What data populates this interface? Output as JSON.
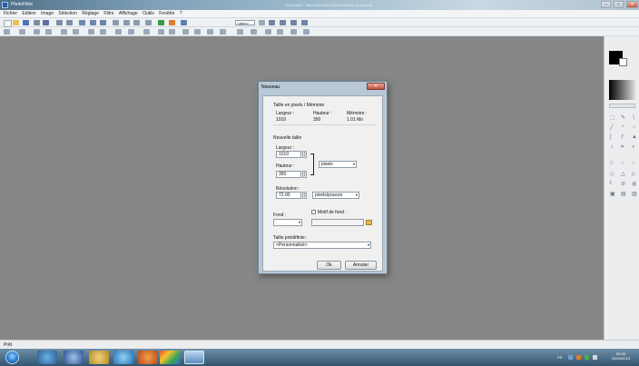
{
  "window": {
    "app_title": "PhotoFiltre",
    "doc_title": "Document - Microsoft Word (Désactivation du produit)",
    "controls": {
      "minimize": "–",
      "maximize": "□",
      "close": "✕"
    }
  },
  "menu": [
    "Fichier",
    "Edition",
    "Image",
    "Sélection",
    "Réglage",
    "Filtre",
    "Affichage",
    "Outils",
    "Fenêtre",
    "?"
  ],
  "toolbar": {
    "zoom_value": "<Auto>"
  },
  "dialog": {
    "title": "Nouveau",
    "close": "✕",
    "section_memory": "Taille en pixels / Mémoire",
    "memory_headers": [
      "Largeur :",
      "Hauteur :",
      "Mémoire :"
    ],
    "memory_values": [
      "1010",
      "350",
      "1.01 Mo"
    ],
    "section_new": "Nouvelle taille",
    "width_label": "Largeur :",
    "width_value": "1010",
    "height_label": "Hauteur :",
    "height_value": "350",
    "unit_value": "pixels",
    "resolution_label": "Résolution :",
    "resolution_value": "72.00",
    "resolution_unit": "pixels/pouces",
    "background_label": "Fond :",
    "pattern_label": "Motif de fond :",
    "preset_label": "Taille prédéfinie :",
    "preset_value": "<Personnalisé>",
    "ok_label": "Ok",
    "cancel_label": "Annuler"
  },
  "status": {
    "text": "Prêt"
  },
  "taskbar": {
    "lang": "FR",
    "time": "09:26",
    "date": "26/04/2013"
  },
  "colors": {
    "workspace": "#868686",
    "dialog_frame": "#b8c8d6",
    "taskbar": "#33556f"
  }
}
